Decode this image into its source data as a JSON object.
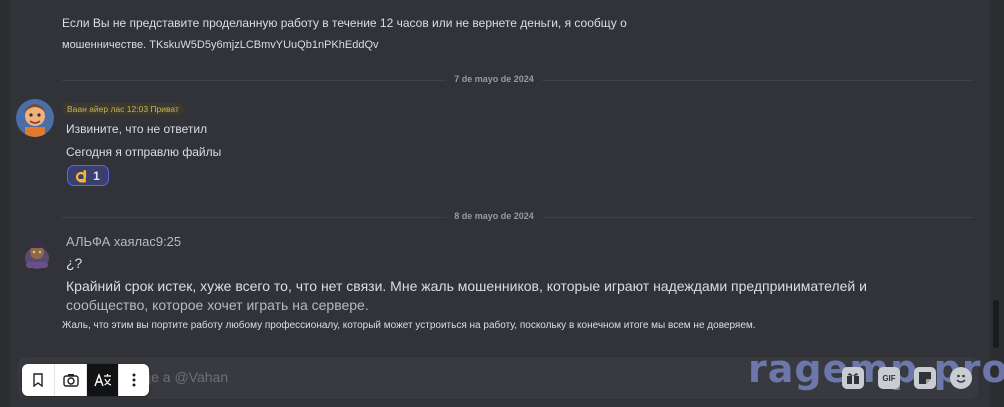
{
  "earlier_message": {
    "line1": "Если Вы не представите проделанную работу в течение 12 часов или не вернете деньги, я сообщу о",
    "line2": "мошенничестве. TKskuW5D5y6mjzLCBmvYUuQb1nPKhEddQv"
  },
  "dividers": [
    {
      "date": "7 de mayo de 2024"
    },
    {
      "date": "8 de mayo de 2024"
    }
  ],
  "message_vahan": {
    "header": "Ваан айер лас 12:03 Приват",
    "lines": [
      "Извините, что не ответил",
      "Сегодня я отправлю файлы"
    ],
    "reaction": {
      "emoji": "ok-hand-icon",
      "count": "1"
    }
  },
  "message_alfa": {
    "author": "АЛЬФА хаялас9:25",
    "lines": [
      "¿?",
      "Крайний срок истек, хуже всего то, что нет связи. Мне жаль мошенников, которые играют надеждами предпринимателей и",
      "сообщество, которое хочет играть на сервере.",
      "Жаль, что этим вы портите работу любому профессионалу, который может устроиться на работу, поскольку в конечном итоге мы всем не доверяем."
    ]
  },
  "composer": {
    "placeholder": "je a @Vahan",
    "gif_label": "GIF"
  },
  "watermark": "ragemp.pro",
  "colors": {
    "background": "#313338",
    "accent": "#5865f2",
    "badge": "#c9b458"
  }
}
